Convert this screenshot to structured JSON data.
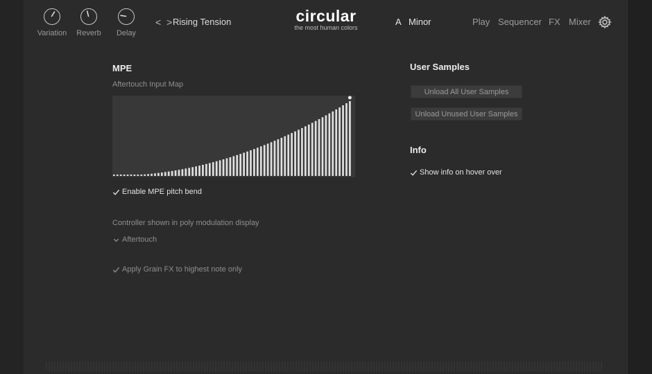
{
  "header": {
    "knobs": [
      {
        "label": "Variation",
        "value": 0.62
      },
      {
        "label": "Reverb",
        "value": 0.45
      },
      {
        "label": "Delay",
        "value": 0.2
      }
    ],
    "preset_arrows": "< >",
    "preset_name": "Rising Tension",
    "logo": {
      "main": "circular",
      "sub": "the most human colors"
    },
    "key": "A",
    "scale": "Minor",
    "nav": {
      "play": "Play",
      "sequencer": "Sequencer",
      "fx": "FX",
      "mixer": "Mixer"
    }
  },
  "mpe": {
    "title": "MPE",
    "aftertouch_map_label": "Aftertouch Input Map",
    "curve_exponent": 2,
    "bar_count": 70,
    "pitch_bend_label": "Enable MPE pitch bend",
    "pitch_bend_enabled": true,
    "controller_label": "Controller shown in poly modulation display",
    "controller_value": "Aftertouch",
    "grain_fx_label": "Apply Grain FX to highest note only",
    "grain_fx_enabled": true
  },
  "user_samples": {
    "title": "User Samples",
    "unload_all_label": "Unload All User Samples",
    "unload_unused_label": "Unload Unused User Samples"
  },
  "info": {
    "title": "Info",
    "hover_label": "Show info on hover over",
    "hover_enabled": true
  },
  "colors": {
    "background": "#2b2b2b",
    "chart_bg": "#383838",
    "bars": "#e0e0e0",
    "text_primary": "#e2e2e2",
    "text_secondary": "#8f8f8f"
  }
}
